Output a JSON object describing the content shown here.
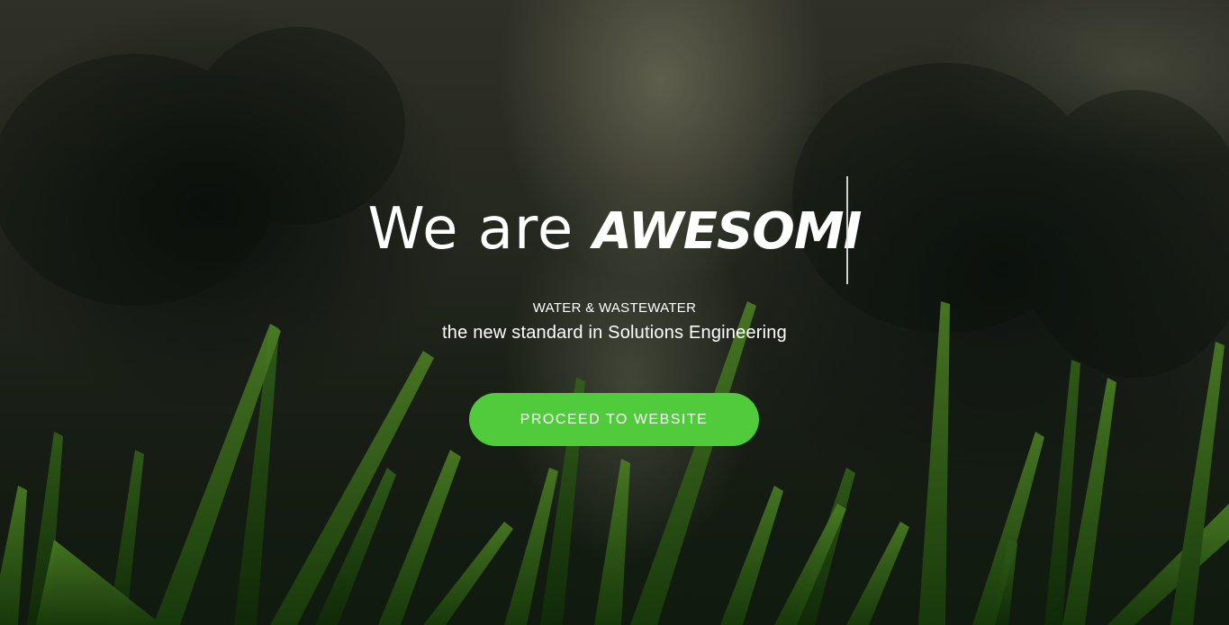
{
  "hero": {
    "headline_static": "We are ",
    "headline_typed": "AWESOMI",
    "subtitle_small": "WATER & WASTEWATER",
    "subtitle_large": "the new standard in Solutions Engineering",
    "cta_label": "PROCEED TO WEBSITE"
  },
  "colors": {
    "cta_background": "#4fcb3c",
    "text": "#ffffff",
    "grass": "#3f7a1f"
  }
}
